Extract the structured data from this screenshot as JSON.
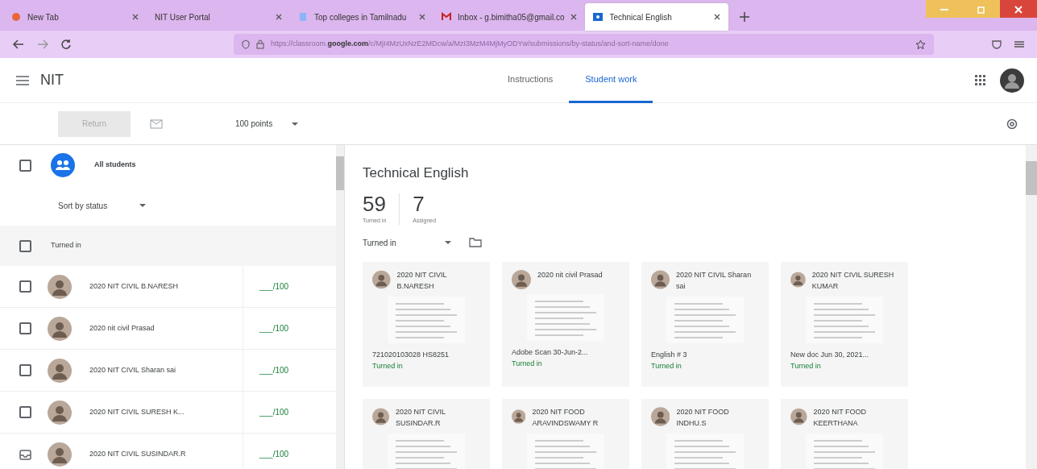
{
  "browser": {
    "tabs": [
      {
        "title": "New Tab",
        "selected": false
      },
      {
        "title": "NIT User Portal",
        "selected": false
      },
      {
        "title": "Top colleges in Tamilnadu",
        "selected": false
      },
      {
        "title": "Inbox - g.bimitha05@gmail.co",
        "selected": false
      },
      {
        "title": "Technical English",
        "selected": true
      }
    ],
    "url_start": "https://classroom.",
    "url_domain": "google.com",
    "url_rest": "/c/MjI4MzUxNzE2MDcw/a/MzI3MzM4MjMyODYw/submissions/by-status/and-sort-name/done"
  },
  "app": {
    "course": "NIT",
    "tabs": [
      {
        "label": "Instructions",
        "selected": false
      },
      {
        "label": "Student work",
        "selected": true
      }
    ],
    "return_button": {
      "label": "Return",
      "disabled": true
    },
    "points": "100 points"
  },
  "roster": {
    "all_students": "All students",
    "all_checked": false,
    "sort": "Sort by status",
    "group": "Turned in",
    "group_checked": false,
    "students": [
      {
        "name": "2020 NIT CIVIL B.NARESH",
        "grade": "___/100",
        "kind": "checkbox",
        "checked": false
      },
      {
        "name": "2020 nit civil Prasad",
        "grade": "___/100",
        "kind": "checkbox",
        "checked": false
      },
      {
        "name": "2020 NIT CIVIL Sharan sai",
        "grade": "___/100",
        "kind": "checkbox",
        "checked": false
      },
      {
        "name": "2020 NIT CIVIL SURESH K...",
        "grade": "___/100",
        "kind": "checkbox",
        "checked": false
      },
      {
        "name": "2020 NIT CIVIL SUSINDAR.R",
        "grade": "___/100",
        "kind": "inbox"
      }
    ]
  },
  "main": {
    "title": "Technical English",
    "stats": [
      {
        "value": "59",
        "label": "Turned in"
      },
      {
        "value": "7",
        "label": "Assigned"
      }
    ],
    "filter": "Turned in",
    "cards": [
      {
        "name": "2020 NIT CIVIL B.NARESH",
        "file": "721020103028 HS8251",
        "status": "Turned in"
      },
      {
        "name": "2020 nit civil Prasad",
        "file": "Adobe Scan 30-Jun-2...",
        "status": "Turned in"
      },
      {
        "name": "2020 NIT CIVIL Sharan sai",
        "file": "English # 3",
        "status": "Turned in"
      },
      {
        "name": "2020 NIT CIVIL SURESH KUMAR",
        "file": "New doc Jun 30, 2021...",
        "status": "Turned in"
      },
      {
        "name": "2020 NIT CIVIL SUSINDAR.R"
      },
      {
        "name": "2020 NIT FOOD ARAVINDSWAMY R"
      },
      {
        "name": "2020 NIT FOOD INDHU.S"
      },
      {
        "name": "2020 NIT FOOD KEERTHANA"
      }
    ]
  }
}
